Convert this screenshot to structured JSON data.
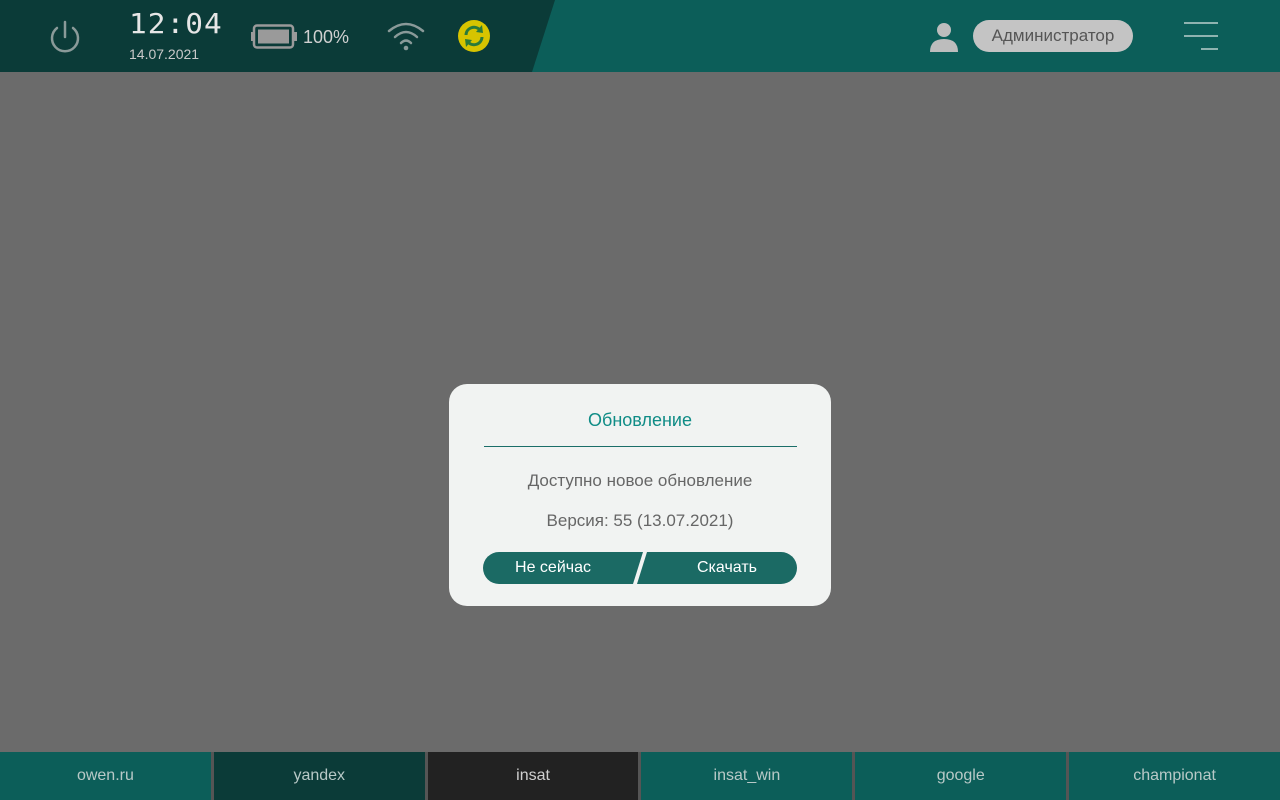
{
  "status_bar": {
    "time": "12:04",
    "date": "14.07.2021",
    "battery": "100%",
    "user": "Администратор"
  },
  "icons": [
    "power-icon",
    "battery-icon",
    "wifi-icon",
    "sync-icon",
    "user-icon",
    "menu-icon"
  ],
  "colors": {
    "bar": "#0c5e59",
    "bar_dark": "#0b3b38",
    "accent": "#0f8c86",
    "button": "#1b6a64",
    "sync": "#d7c400"
  },
  "dialog": {
    "title": "Обновление",
    "message": "Доступно новое обновление",
    "version": "Версия: 55 (13.07.2021)",
    "cancel_label": "Не сейчас",
    "download_label": "Скачать"
  },
  "tabs": [
    {
      "label": "owen.ru"
    },
    {
      "label": "yandex"
    },
    {
      "label": "insat"
    },
    {
      "label": "insat_win"
    },
    {
      "label": "google"
    },
    {
      "label": "championat"
    }
  ]
}
